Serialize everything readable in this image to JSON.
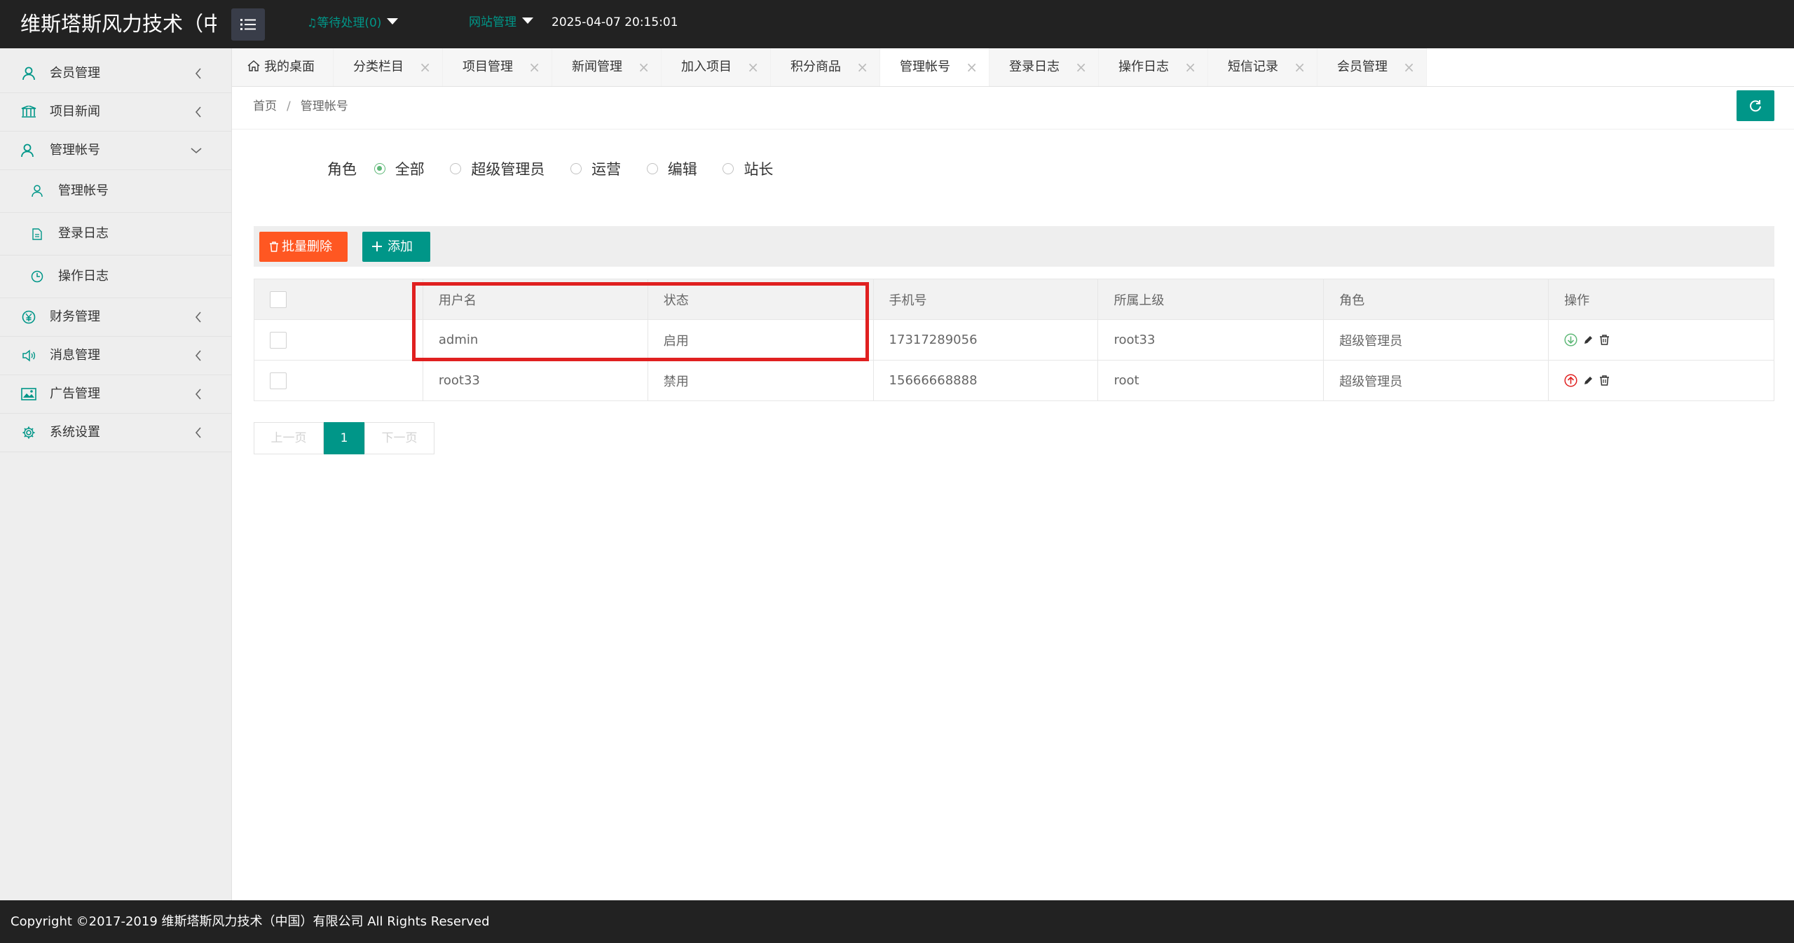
{
  "header": {
    "logo": "维斯塔斯风力技术（中",
    "pending": "等待处理(0)",
    "site_mgmt": "网站管理",
    "datetime": "2025-04-07 20:15:01",
    "accent": "#009688"
  },
  "sidebar": {
    "items": [
      {
        "label": "会员管理",
        "icon": "user-icon"
      },
      {
        "label": "项目新闻",
        "icon": "library-icon"
      },
      {
        "label": "管理帐号",
        "icon": "admin-icon",
        "expanded": true
      },
      {
        "label": "财务管理",
        "icon": "yen-icon"
      },
      {
        "label": "消息管理",
        "icon": "speaker-icon"
      },
      {
        "label": "广告管理",
        "icon": "picture-icon"
      },
      {
        "label": "系统设置",
        "icon": "gear-icon"
      }
    ],
    "sub_items": [
      {
        "label": "管理帐号",
        "icon": "user-icon"
      },
      {
        "label": "登录日志",
        "icon": "file-icon"
      },
      {
        "label": "操作日志",
        "icon": "clock-icon"
      }
    ]
  },
  "tabs": [
    {
      "label": "我的桌面",
      "icon": "home-icon"
    },
    {
      "label": "分类栏目"
    },
    {
      "label": "项目管理"
    },
    {
      "label": "新闻管理"
    },
    {
      "label": "加入项目"
    },
    {
      "label": "积分商品"
    },
    {
      "label": "管理帐号",
      "active": true
    },
    {
      "label": "登录日志"
    },
    {
      "label": "操作日志"
    },
    {
      "label": "短信记录"
    },
    {
      "label": "会员管理"
    }
  ],
  "breadcrumb": {
    "home": "首页",
    "sep": "/",
    "current": "管理帐号"
  },
  "filter": {
    "label": "角色",
    "options": [
      "全部",
      "超级管理员",
      "运营",
      "编辑",
      "站长"
    ],
    "selected": "全部"
  },
  "toolbar": {
    "batch_delete": "批量删除",
    "add": "添加"
  },
  "table": {
    "columns": [
      "用户名",
      "状态",
      "手机号",
      "所属上级",
      "角色",
      "操作"
    ],
    "rows": [
      {
        "username": "admin",
        "status": "启用",
        "phone": "17317289056",
        "parent": "root33",
        "role": "超级管理员",
        "toggle": "down-circle-icon"
      },
      {
        "username": "root33",
        "status": "禁用",
        "phone": "15666668888",
        "parent": "root",
        "role": "超级管理员",
        "toggle": "up-circle-icon"
      }
    ]
  },
  "pagination": {
    "prev": "上一页",
    "current": "1",
    "next": "下一页"
  },
  "footer": {
    "copyright": "Copyright ©2017-2019 维斯塔斯风力技术（中国）有限公司 All Rights Reserved"
  }
}
